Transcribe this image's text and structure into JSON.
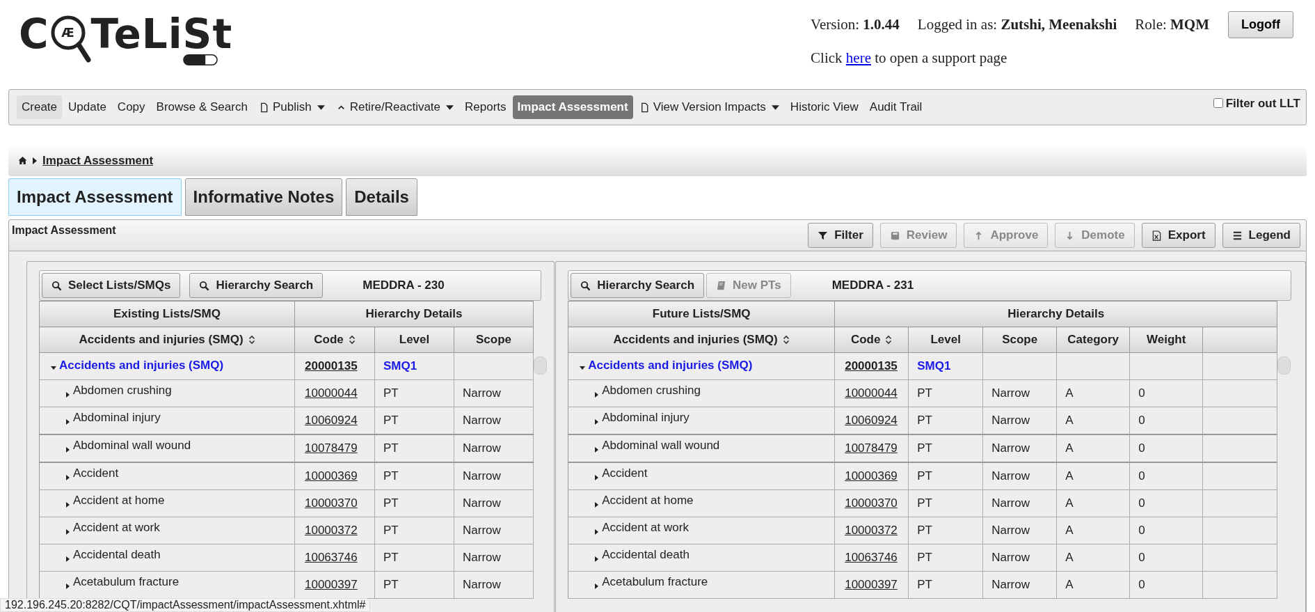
{
  "logo": {
    "start": "C",
    "glass": "Æ",
    "end": "TeLiSt"
  },
  "header": {
    "version_label": "Version:",
    "version": "1.0.44",
    "user_label": "Logged in as:",
    "user": "Zutshi, Meenakshi",
    "role_label": "Role:",
    "role": "MQM",
    "logoff": "Logoff",
    "support": {
      "before": "Click",
      "link": "here",
      "after": "to open a support page"
    }
  },
  "nav": {
    "items": [
      {
        "label": "Create",
        "selected": false,
        "hovered": true
      },
      {
        "label": "Update",
        "selected": false,
        "hovered": false
      },
      {
        "label": "Copy",
        "selected": false,
        "hovered": false
      },
      {
        "label": "Browse & Search",
        "selected": false,
        "hovered": false
      },
      {
        "label": "Publish",
        "selected": false,
        "hovered": false,
        "dropdown": true
      },
      {
        "label": "Retire/Reactivate",
        "selected": false,
        "hovered": false,
        "dropdown": true
      },
      {
        "label": "Reports",
        "selected": false,
        "hovered": false
      },
      {
        "label": "Impact Assessment",
        "selected": true,
        "hovered": false
      },
      {
        "label": "View Version Impacts",
        "selected": false,
        "hovered": false,
        "dropdown": true
      },
      {
        "label": "Historic View",
        "selected": false,
        "hovered": false
      },
      {
        "label": "Audit Trail",
        "selected": false,
        "hovered": false
      }
    ],
    "filter_llt": {
      "label": "Filter out LLT",
      "checked": false
    }
  },
  "breadcrumb": {
    "current": "Impact Assessment"
  },
  "tabs": [
    {
      "label": "Impact Assessment",
      "selected": true
    },
    {
      "label": "Informative Notes",
      "selected": false
    },
    {
      "label": "Details",
      "selected": false
    }
  ],
  "panel": {
    "title": "Impact Assessment",
    "actions": [
      {
        "label": "Filter",
        "disabled": false
      },
      {
        "label": "Review",
        "disabled": true
      },
      {
        "label": "Approve",
        "disabled": true
      },
      {
        "label": "Demote",
        "disabled": true
      },
      {
        "label": "Export",
        "disabled": false
      },
      {
        "label": "Legend",
        "disabled": false
      }
    ]
  },
  "lists": [
    {
      "toolbar": [
        {
          "label": "Select Lists/SMQs",
          "disabled": false
        },
        {
          "label": "Hierarchy Search",
          "disabled": false
        }
      ],
      "version": "MEDDRA - 230",
      "group_headers": [
        "Existing Lists/SMQ",
        "Hierarchy Details"
      ],
      "columns": [
        {
          "label": "Accidents and injuries (SMQ)",
          "sortable": true
        },
        {
          "label": "Code",
          "sortable": true
        },
        {
          "label": "Level",
          "sortable": false
        },
        {
          "label": "Scope",
          "sortable": false
        }
      ],
      "rows": [
        {
          "kind": "group",
          "expanded": true,
          "name": "Accidents and injuries (SMQ)",
          "code": "20000135",
          "level": "SMQ1"
        },
        {
          "kind": "term",
          "expanded": false,
          "name": "Abdomen crushing",
          "code": "10000044",
          "level": "PT",
          "scope": "Narrow"
        },
        {
          "kind": "term",
          "expanded": false,
          "name": "Abdominal injury",
          "code": "10060924",
          "level": "PT",
          "scope": "Narrow"
        },
        {
          "kind": "term",
          "expanded": false,
          "name": "Abdominal wall wound",
          "code": "10078479",
          "level": "PT",
          "scope": "Narrow"
        },
        {
          "kind": "term",
          "expanded": false,
          "name": "Accident",
          "code": "10000369",
          "level": "PT",
          "scope": "Narrow"
        },
        {
          "kind": "term",
          "expanded": false,
          "name": "Accident at home",
          "code": "10000370",
          "level": "PT",
          "scope": "Narrow"
        },
        {
          "kind": "term",
          "expanded": false,
          "name": "Accident at work",
          "code": "10000372",
          "level": "PT",
          "scope": "Narrow"
        },
        {
          "kind": "term",
          "expanded": false,
          "name": "Accidental death",
          "code": "10063746",
          "level": "PT",
          "scope": "Narrow"
        },
        {
          "kind": "term",
          "expanded": false,
          "name": "Acetabulum fracture",
          "code": "10000397",
          "level": "PT",
          "scope": "Narrow"
        }
      ]
    },
    {
      "toolbar": [
        {
          "label": "Hierarchy Search",
          "disabled": false
        },
        {
          "label": "New PTs",
          "disabled": true
        }
      ],
      "version": "MEDDRA - 231",
      "group_headers": [
        "Future Lists/SMQ",
        "Hierarchy Details"
      ],
      "columns": [
        {
          "label": "Accidents and injuries (SMQ)",
          "sortable": true
        },
        {
          "label": "Code",
          "sortable": true
        },
        {
          "label": "Level",
          "sortable": false
        },
        {
          "label": "Scope",
          "sortable": false
        },
        {
          "label": "Category",
          "sortable": false
        },
        {
          "label": "Weight",
          "sortable": false
        }
      ],
      "rows": [
        {
          "kind": "group",
          "expanded": true,
          "name": "Accidents and injuries (SMQ)",
          "code": "20000135",
          "level": "SMQ1"
        },
        {
          "kind": "term",
          "expanded": false,
          "name": "Abdomen crushing",
          "code": "10000044",
          "level": "PT",
          "scope": "Narrow",
          "category": "A",
          "weight": "0"
        },
        {
          "kind": "term",
          "expanded": false,
          "name": "Abdominal injury",
          "code": "10060924",
          "level": "PT",
          "scope": "Narrow",
          "category": "A",
          "weight": "0"
        },
        {
          "kind": "term",
          "expanded": false,
          "name": "Abdominal wall wound",
          "code": "10078479",
          "level": "PT",
          "scope": "Narrow",
          "category": "A",
          "weight": "0"
        },
        {
          "kind": "term",
          "expanded": false,
          "name": "Accident",
          "code": "10000369",
          "level": "PT",
          "scope": "Narrow",
          "category": "A",
          "weight": "0"
        },
        {
          "kind": "term",
          "expanded": false,
          "name": "Accident at home",
          "code": "10000370",
          "level": "PT",
          "scope": "Narrow",
          "category": "A",
          "weight": "0"
        },
        {
          "kind": "term",
          "expanded": false,
          "name": "Accident at work",
          "code": "10000372",
          "level": "PT",
          "scope": "Narrow",
          "category": "A",
          "weight": "0"
        },
        {
          "kind": "term",
          "expanded": false,
          "name": "Accidental death",
          "code": "10063746",
          "level": "PT",
          "scope": "Narrow",
          "category": "A",
          "weight": "0"
        },
        {
          "kind": "term",
          "expanded": false,
          "name": "Acetabulum fracture",
          "code": "10000397",
          "level": "PT",
          "scope": "Narrow",
          "category": "A",
          "weight": "0"
        }
      ]
    }
  ],
  "status_bar": {
    "url": "192.196.245.20:8282/CQT/impactAssessment/impactAssessment.xhtml#"
  }
}
